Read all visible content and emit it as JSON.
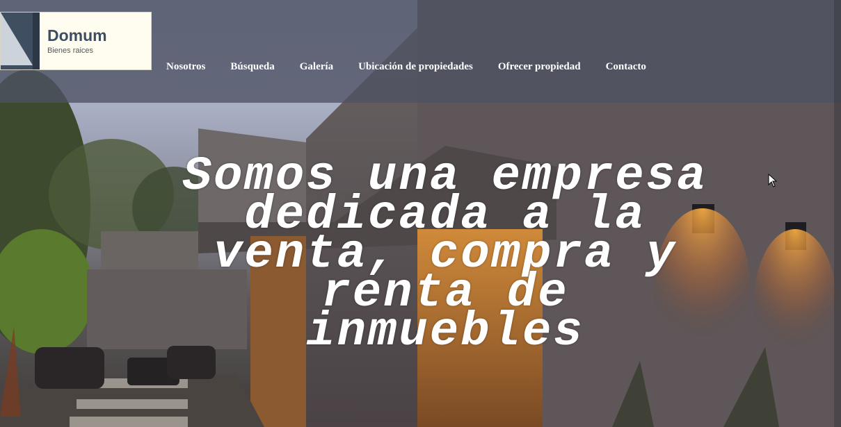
{
  "brand": {
    "name": "Domum",
    "tagline": "Bienes raices"
  },
  "nav": {
    "items": [
      "Nosotros",
      "Búsqueda",
      "Galería",
      "Ubicación de propiedades",
      "Ofrecer propiedad",
      "Contacto"
    ]
  },
  "hero": {
    "headline": "Somos una empresa dedicada a la venta, compra y renta de inmuebles"
  },
  "colors": {
    "topbar": "#4e5263",
    "logo_bg": "#fffdf0",
    "logo_mark": "#3f4e60",
    "logo_text": "#3e4e61",
    "nav_text": "#ffffff",
    "headline_text": "#ffffff"
  },
  "icons": [
    "logo-mark-icon",
    "cursor-icon",
    "wall-lamp-icon"
  ]
}
